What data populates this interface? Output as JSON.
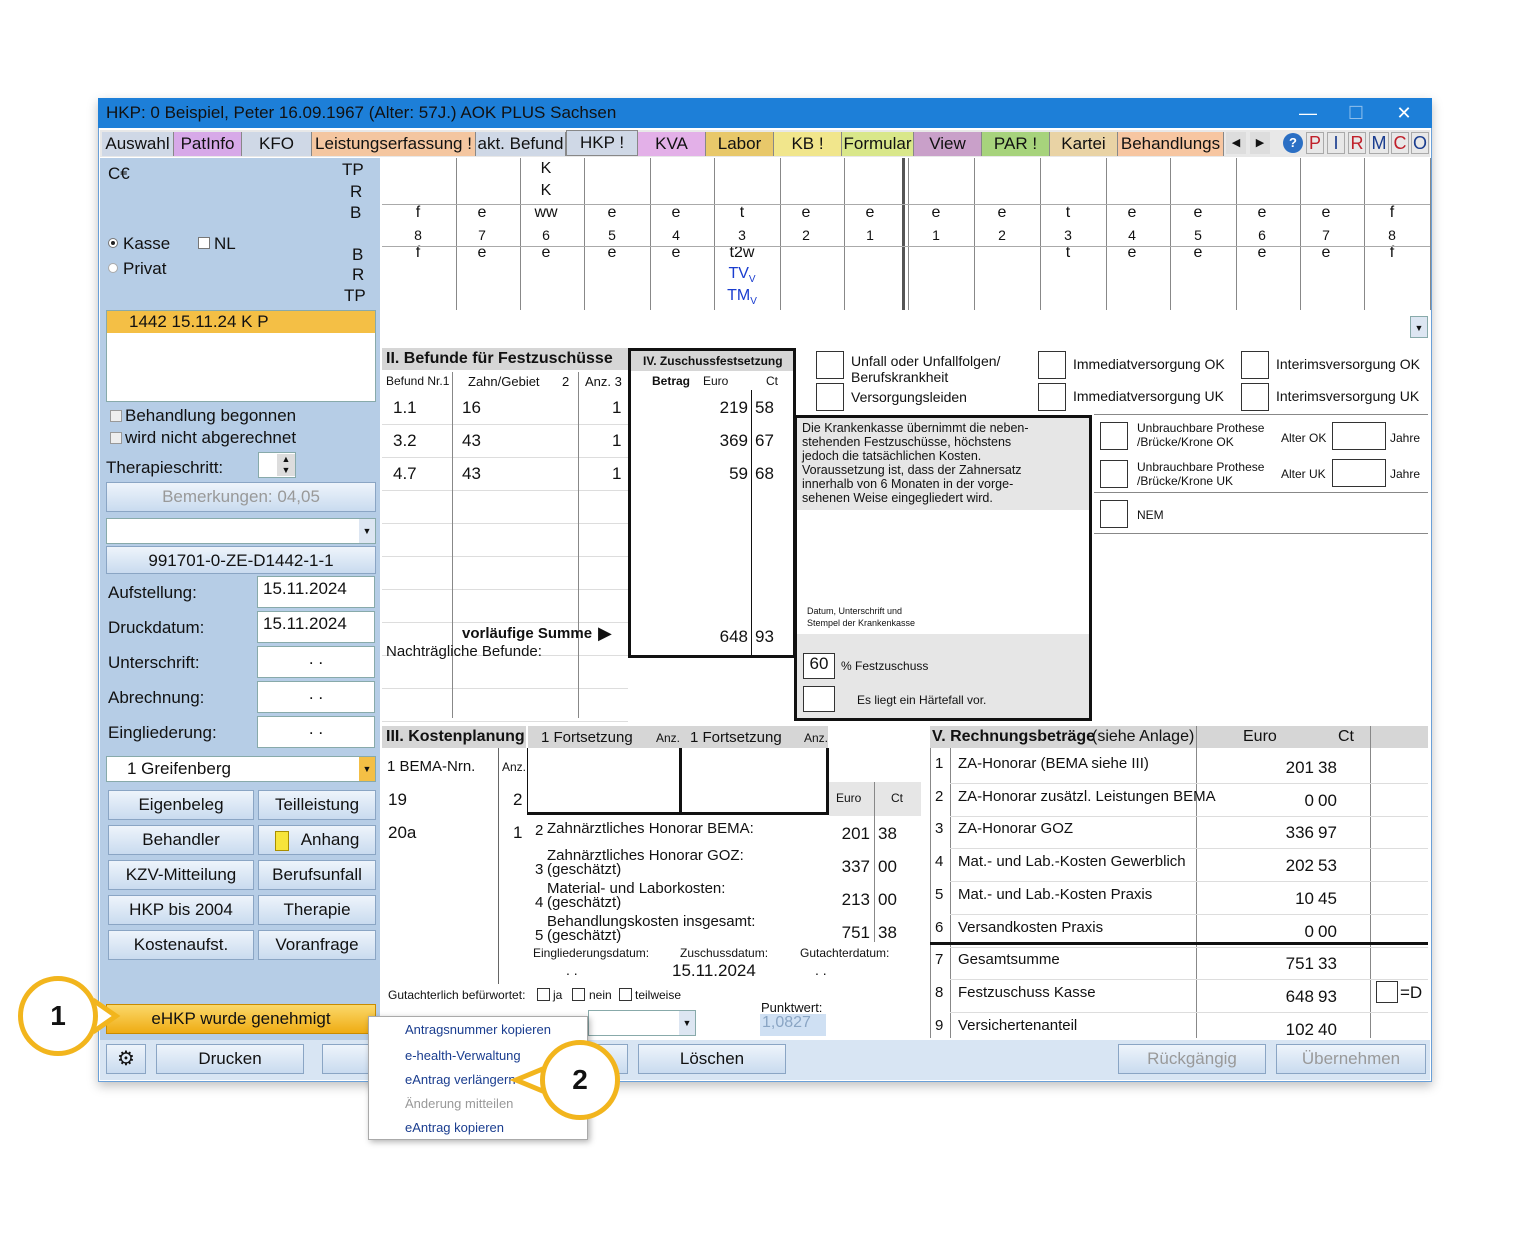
{
  "window": {
    "title": "HKP: 0  Beispiel, Peter  16.09.1967 (Alter: 57J.)  AOK PLUS Sachsen"
  },
  "tabs": [
    "Auswahl",
    "PatInfo",
    "KFO",
    "Leistungserfassung !",
    "akt. Befund",
    "HKP !",
    "KVA",
    "Labor",
    "KB !",
    "Formular",
    "View",
    "PAR !",
    "Kartei",
    "Behandlungs"
  ],
  "tab_colors": [
    "#cfd8e6",
    "#d7a9e8",
    "#cfd8e6",
    "#f4c6a0",
    "#cfd8e6",
    "#cfd8e6",
    "#e3b0e8",
    "#e8c86a",
    "#f1e68c",
    "#d9e78a",
    "#c9a0c9",
    "#a7d37c",
    "#e9d3a5",
    "#f7c6a1"
  ],
  "quick": {
    "help": "?",
    "p": "P",
    "i": "I",
    "r": "R",
    "m": "M",
    "c": "C",
    "o": "O"
  },
  "left": {
    "ce": "C€",
    "tp_top": "TP",
    "r_top": "R",
    "b_top": "B",
    "kasse": "Kasse",
    "nl": "NL",
    "privat": "Privat",
    "b_bot": "B",
    "r_bot": "R",
    "tp_bot": "TP",
    "list_item": "1442 15.11.24 K P",
    "beh_begonnen": "Behandlung begonnen",
    "nicht_abgerechnet": "wird nicht abgerechnet",
    "therapieschritt": "Therapieschritt:",
    "bemerkungen": "Bemerkungen: 04,05",
    "code": "991701-0-ZE-D1442-1-1",
    "aufstellung": "Aufstellung:",
    "aufstellung_val": "15.11.2024",
    "druckdatum": "Druckdatum:",
    "druckdatum_val": "15.11.2024",
    "unterschrift": "Unterschrift:",
    "unterschrift_val": ". .",
    "abrechnung": "Abrechnung:",
    "abrechnung_val": ". .",
    "eingliederung": "Eingliederung:",
    "eingliederung_val": ". .",
    "greifenberg": "1 Greifenberg",
    "btns": [
      "Eigenbeleg",
      "Teilleistung",
      "Behandler",
      "Anhang",
      "KZV-Mitteilung",
      "Berufsunfall",
      "HKP bis 2004",
      "Therapie",
      "Kostenaufst.",
      "Voranfrage"
    ],
    "ehkp": "eHKP wurde genehmigt"
  },
  "teeth": {
    "k1": "K",
    "k2": "K",
    "row1": [
      "f",
      "e",
      "ww",
      "e",
      "e",
      "t",
      "e",
      "e",
      "e",
      "e",
      "t",
      "e",
      "e",
      "e",
      "e",
      "f"
    ],
    "nums": [
      "8",
      "7",
      "6",
      "5",
      "4",
      "3",
      "2",
      "1",
      "1",
      "2",
      "3",
      "4",
      "5",
      "6",
      "7",
      "8"
    ],
    "row3": [
      "f",
      "e",
      "e",
      "e",
      "e",
      "t2w",
      "",
      "",
      "",
      "",
      "t",
      "e",
      "e",
      "e",
      "e",
      "f"
    ],
    "tv": "TV",
    "tm": "TM",
    "v": "V"
  },
  "befunde": {
    "title": "II. Befunde für Festzuschüsse",
    "h1": "Befund Nr.1",
    "h2": "Zahn/Gebiet",
    "h2b": "2",
    "h3": "Anz. 3",
    "rows": [
      {
        "nr": "1.1",
        "zahn": "16",
        "anz": "1"
      },
      {
        "nr": "3.2",
        "zahn": "43",
        "anz": "1"
      },
      {
        "nr": "4.7",
        "zahn": "43",
        "anz": "1"
      }
    ],
    "summe": "vorläufige Summe",
    "nachtr": "Nachträgliche Befunde:"
  },
  "zuschuss": {
    "title": "IV. Zuschussfestsetzung",
    "betrag": "Betrag",
    "euro": "Euro",
    "ct": "Ct",
    "rows": [
      {
        "e": "219",
        "c": "58"
      },
      {
        "e": "369",
        "c": "67"
      },
      {
        "e": "59",
        "c": "68"
      }
    ],
    "sum_e": "648",
    "sum_c": "93"
  },
  "kasse": {
    "text": "Die Krankenkasse übernimmt die neben-\nstehenden Festzuschüsse, höchstens\njedoch die tatsächlichen Kosten.\nVoraussetzung ist, dass der Zahnersatz\ninnerhalb von 6 Monaten in der vorge-\nsehenen Weise eingegliedert wird.",
    "datum": "Datum, Unterschrift und\nStempel der Krankenkasse",
    "pct": "60",
    "festzuschuss": "% Festzuschuss",
    "haerte": "Es liegt ein Härtefall vor."
  },
  "checks": {
    "unfall": "Unfall oder Unfallfolgen/\nBerufskrankheit",
    "versorgungsleiden": "Versorgungsleiden",
    "imm_ok": "Immediatversorgung OK",
    "imm_uk": "Immediatversorgung UK",
    "int_ok": "Interimsversorgung OK",
    "int_uk": "Interimsversorgung UK",
    "prot_ok": "Unbrauchbare Prothese\n/Brücke/Krone OK",
    "prot_uk": "Unbrauchbare Prothese\n/Brücke/Krone UK",
    "alter_ok": "Alter OK",
    "alter_uk": "Alter UK",
    "jahre": "Jahre",
    "nem": "NEM"
  },
  "kosten": {
    "title": "III. Kostenplanung",
    "fort": "1 Fortsetzung",
    "anz": "Anz.",
    "bema": "1 BEMA-Nrn.",
    "rows": [
      {
        "nr": "19",
        "anz": "2"
      },
      {
        "nr": "20a",
        "anz": "1"
      }
    ],
    "euro": "Euro",
    "ct": "Ct",
    "items": [
      {
        "n": "2",
        "t": "Zahnärztliches Honorar BEMA:",
        "t2": "",
        "e": "201",
        "c": "38"
      },
      {
        "n": "3",
        "t": "Zahnärztliches Honorar GOZ:",
        "t2": "(geschätzt)",
        "e": "337",
        "c": "00"
      },
      {
        "n": "4",
        "t": "Material- und Laborkosten:",
        "t2": "(geschätzt)",
        "e": "213",
        "c": "00"
      },
      {
        "n": "5",
        "t": "Behandlungskosten insgesamt:",
        "t2": "(geschätzt)",
        "e": "751",
        "c": "38"
      }
    ],
    "eingl": "Eingliederungsdatum:",
    "zusch": "Zuschussdatum:",
    "zusch_val": "15.11.2024",
    "gut": "Gutachterdatum:",
    "dots": ". .",
    "gutachter": "Gutachterlich befürwortet:",
    "ja": "ja",
    "nein": "nein",
    "teilweise": "teilweise",
    "punktwert": "Punktwert:",
    "punktwert_val": "1,0827"
  },
  "rechnung": {
    "title": "V. Rechnungsbeträge",
    "sub": "(siehe Anlage)",
    "euro": "Euro",
    "ct": "Ct",
    "rows": [
      {
        "n": "1",
        "t": "ZA-Honorar (BEMA siehe III)",
        "e": "201",
        "c": "38"
      },
      {
        "n": "2",
        "t": "ZA-Honorar zusätzl. Leistungen BEMA",
        "e": "0",
        "c": "00"
      },
      {
        "n": "3",
        "t": "ZA-Honorar GOZ",
        "e": "336",
        "c": "97"
      },
      {
        "n": "4",
        "t": "Mat.- und Lab.-Kosten Gewerblich",
        "e": "202",
        "c": "53"
      },
      {
        "n": "5",
        "t": "Mat.- und Lab.-Kosten Praxis",
        "e": "10",
        "c": "45"
      },
      {
        "n": "6",
        "t": "Versandkosten Praxis",
        "e": "0",
        "c": "00"
      },
      {
        "n": "7",
        "t": "Gesamtsumme",
        "e": "751",
        "c": "33"
      },
      {
        "n": "8",
        "t": "Festzuschuss Kasse",
        "e": "648",
        "c": "93"
      },
      {
        "n": "9",
        "t": "Versichertenanteil",
        "e": "102",
        "c": "40"
      }
    ],
    "d": "=D"
  },
  "bottom": {
    "drucken": "Drucken",
    "loeschen": "Löschen",
    "rueck": "Rückgängig",
    "ueber": "Übernehmen"
  },
  "menu": [
    "Antragsnummer kopieren",
    "e-health-Verwaltung",
    "eAntrag verlängern",
    "Änderung mitteilen",
    "eAntrag kopieren"
  ],
  "callouts": {
    "one": "1",
    "two": "2"
  }
}
